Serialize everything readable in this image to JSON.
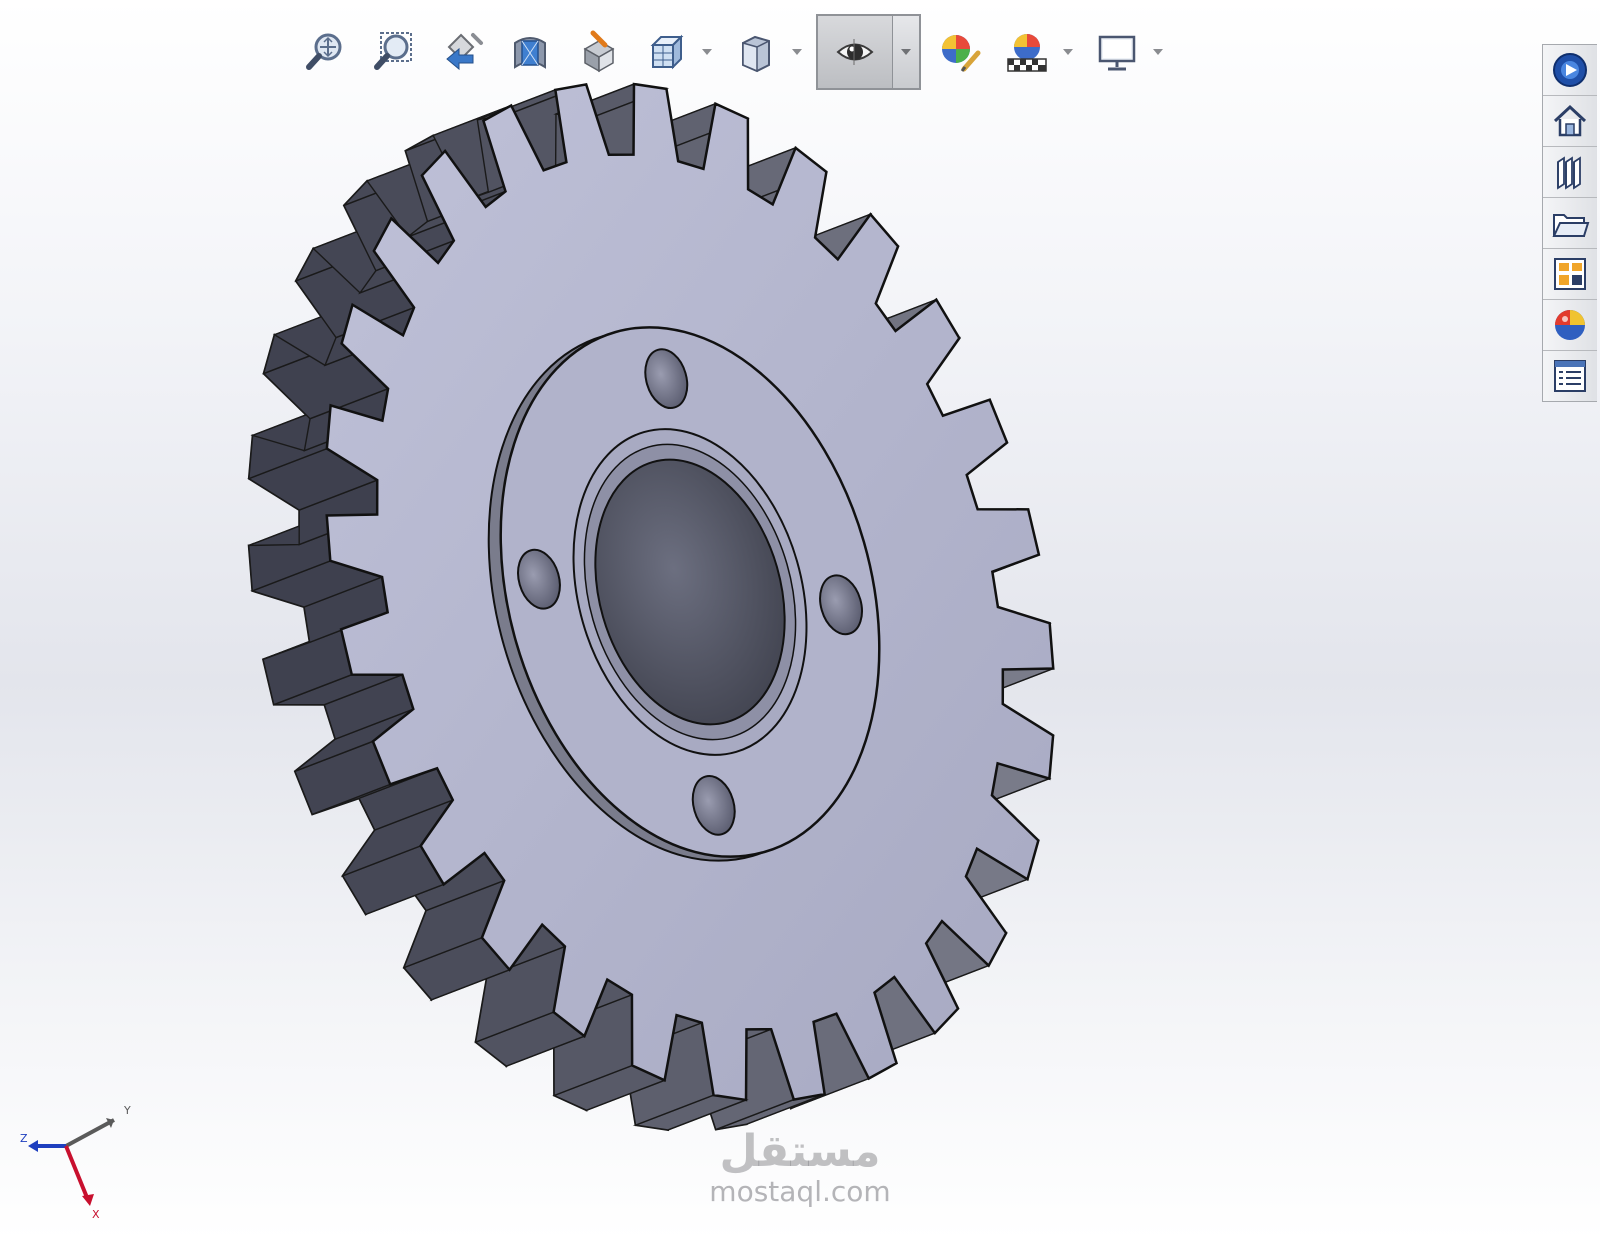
{
  "toolbar": {
    "tools": [
      {
        "name": "zoom-to-fit-icon"
      },
      {
        "name": "zoom-to-area-icon"
      },
      {
        "name": "previous-view-icon"
      },
      {
        "name": "section-view-icon"
      },
      {
        "name": "view-selector-icon"
      },
      {
        "name": "view-orientation-icon"
      },
      {
        "name": "display-style-icon"
      },
      {
        "name": "hide-show-items-icon"
      },
      {
        "name": "edit-appearance-icon"
      },
      {
        "name": "apply-scene-icon"
      },
      {
        "name": "view-settings-icon"
      }
    ],
    "active_tool": "hide-show-items-icon"
  },
  "task_pane": {
    "tabs": [
      {
        "name": "solidworks-resources-icon"
      },
      {
        "name": "home-icon"
      },
      {
        "name": "design-library-icon"
      },
      {
        "name": "file-explorer-icon"
      },
      {
        "name": "view-palette-icon"
      },
      {
        "name": "appearances-scenes-icon"
      },
      {
        "name": "custom-properties-icon"
      }
    ]
  },
  "triad": {
    "x_label": "X",
    "y_label": "Y",
    "z_label": "Z",
    "x_color": "#c8102e",
    "y_color": "#5a5a5a",
    "z_color": "#1e3fbf"
  },
  "model": {
    "type": "gear",
    "tooth_count": 28,
    "bolt_holes": 4,
    "face_color": "#b3b5ce",
    "side_color": "#6e7080",
    "bore_color": "#4f5260"
  },
  "watermark": {
    "arabic": "مستقل",
    "latin": "mostaql.com"
  }
}
